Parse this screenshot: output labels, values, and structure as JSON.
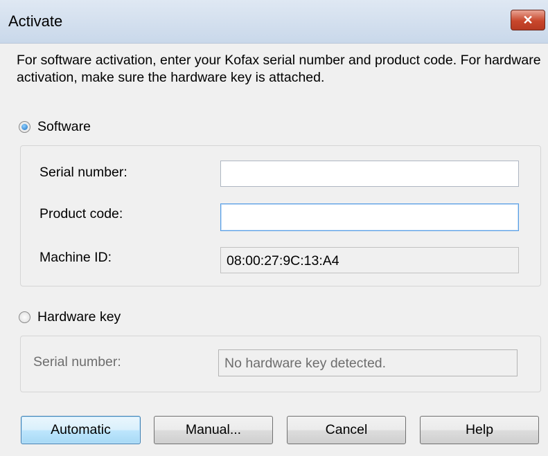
{
  "window": {
    "title": "Activate",
    "close_label": "✕"
  },
  "intro_text": "For software activation, enter your Kofax serial number and product code.  For hardware activation, make sure the hardware key is attached.",
  "software": {
    "label": "Software",
    "selected": true,
    "serial_label": "Serial number:",
    "serial_value": "",
    "product_label": "Product code:",
    "product_value": "",
    "machine_label": "Machine ID:",
    "machine_value": "08:00:27:9C:13:A4"
  },
  "hardware": {
    "label": "Hardware key",
    "selected": false,
    "serial_label": "Serial number:",
    "serial_value": "No hardware key detected."
  },
  "buttons": {
    "automatic": "Automatic",
    "manual": "Manual...",
    "cancel": "Cancel",
    "help": "Help"
  },
  "colors": {
    "close_button": "#c8462b",
    "default_button": "#bee6fd",
    "title_bar": "#d3dfee"
  }
}
